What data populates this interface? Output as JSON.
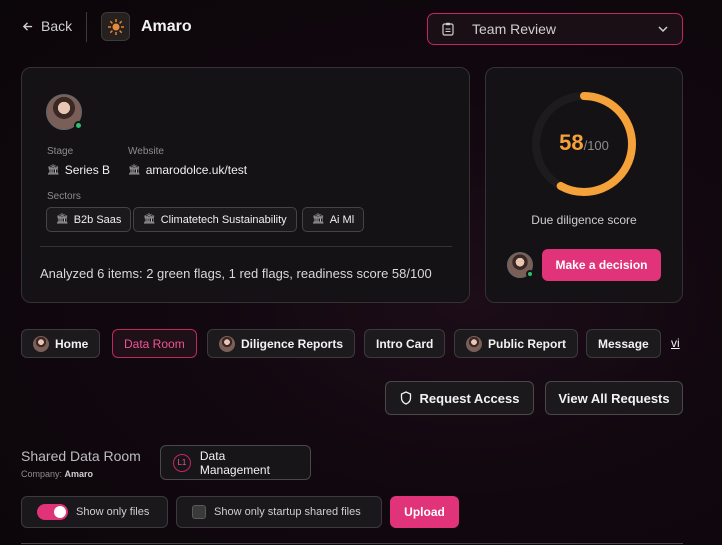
{
  "header": {
    "back_label": "Back",
    "company_name": "Amaro",
    "team_select_value": "Team Review"
  },
  "profile": {
    "stage_label": "Stage",
    "stage_value": "Series B",
    "website_label": "Website",
    "website_value": "amarodolce.uk/test",
    "sectors_label": "Sectors",
    "sectors": [
      "B2b Saas",
      "Climatetech Sustainability",
      "Ai Ml"
    ],
    "summary": "Analyzed 6 items: 2 green flags, 1 red flags, readiness score 58/100"
  },
  "score": {
    "value": 58,
    "max_label": "/100",
    "fraction": 0.58,
    "label": "Due diligence score",
    "decision_label": "Make a decision",
    "color": "#f6a23a"
  },
  "tabs": [
    "Home",
    "Data Room",
    "Diligence Reports",
    "Intro Card",
    "Public Report",
    "Message",
    "vi"
  ],
  "actions": {
    "request_access": "Request Access",
    "view_all_requests": "View All Requests"
  },
  "data_room": {
    "title": "Shared Data Room",
    "company_label": "Company:",
    "company_value": "Amaro",
    "management_badge": "L1",
    "management_label": "Data Management",
    "show_only_files": "Show only files",
    "show_only_startup_shared": "Show only startup shared files",
    "upload_label": "Upload"
  },
  "colors": {
    "accent": "#e0337a",
    "score": "#f6a23a",
    "online": "#2fbf71"
  }
}
